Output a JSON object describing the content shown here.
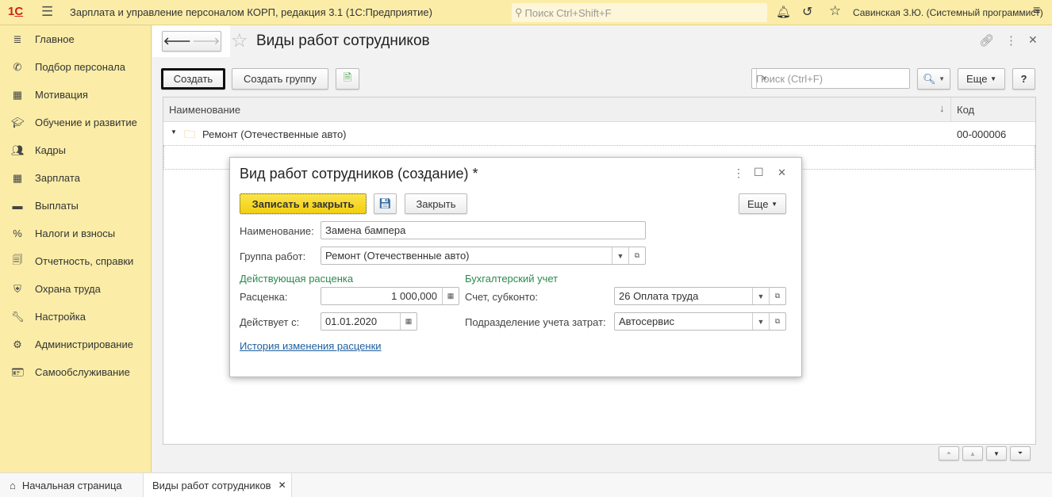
{
  "topbar": {
    "app_title": "Зарплата и управление персоналом КОРП, редакция 3.1  (1С:Предприятие)",
    "search_placeholder": "Поиск Ctrl+Shift+F",
    "user": "Савинская З.Ю. (Системный программист)",
    "logo": "1С"
  },
  "sidebar": {
    "items": [
      {
        "label": "Главное",
        "icon": "menu-icon"
      },
      {
        "label": "Подбор персонала",
        "icon": "phone-icon"
      },
      {
        "label": "Мотивация",
        "icon": "gift-icon"
      },
      {
        "label": "Обучение и развитие",
        "icon": "graduation-cap-icon"
      },
      {
        "label": "Кадры",
        "icon": "people-icon"
      },
      {
        "label": "Зарплата",
        "icon": "calculator-icon"
      },
      {
        "label": "Выплаты",
        "icon": "card-icon"
      },
      {
        "label": "Налоги и взносы",
        "icon": "percent-icon"
      },
      {
        "label": "Отчетность, справки",
        "icon": "reports-icon"
      },
      {
        "label": "Охрана труда",
        "icon": "shield-icon"
      },
      {
        "label": "Настройка",
        "icon": "wrench-icon"
      },
      {
        "label": "Администрирование",
        "icon": "gear-icon"
      },
      {
        "label": "Самообслуживание",
        "icon": "id-card-icon"
      }
    ]
  },
  "page": {
    "title": "Виды работ сотрудников",
    "create": "Создать",
    "create_group": "Создать группу",
    "search_placeholder": "Поиск (Ctrl+F)",
    "more": "Еще",
    "help": "?"
  },
  "table": {
    "columns": [
      "Наименование",
      "Код"
    ],
    "rows": [
      {
        "name": "Ремонт (Отечественные авто)",
        "code": "00-000006"
      }
    ]
  },
  "dialog": {
    "title": "Вид работ сотрудников (создание) *",
    "save_close": "Записать и закрыть",
    "close": "Закрыть",
    "more": "Еще",
    "name_label": "Наименование:",
    "name_value": "Замена бампера",
    "group_label": "Группа работ:",
    "group_value": "Ремонт (Отечественные авто)",
    "section_rate": "Действующая расценка",
    "section_accounting": "Бухгалтерский учет",
    "rate_label": "Расценка:",
    "rate_value": "1 000,000",
    "valid_label": "Действует с:",
    "valid_value": "01.01.2020",
    "account_label": "Счет, субконто:",
    "account_value": "26 Оплата труда",
    "dept_label": "Подразделение учета затрат:",
    "dept_value": "Автосервис",
    "history_link": "История изменения расценки"
  },
  "tabs": [
    {
      "label": "Начальная страница"
    },
    {
      "label": "Виды работ сотрудников"
    }
  ],
  "colors": {
    "accent_yellow": "#fbeda7",
    "primary_button": "#f7d81a",
    "section_green": "#2b8a4e",
    "link": "#1f5f9e"
  }
}
